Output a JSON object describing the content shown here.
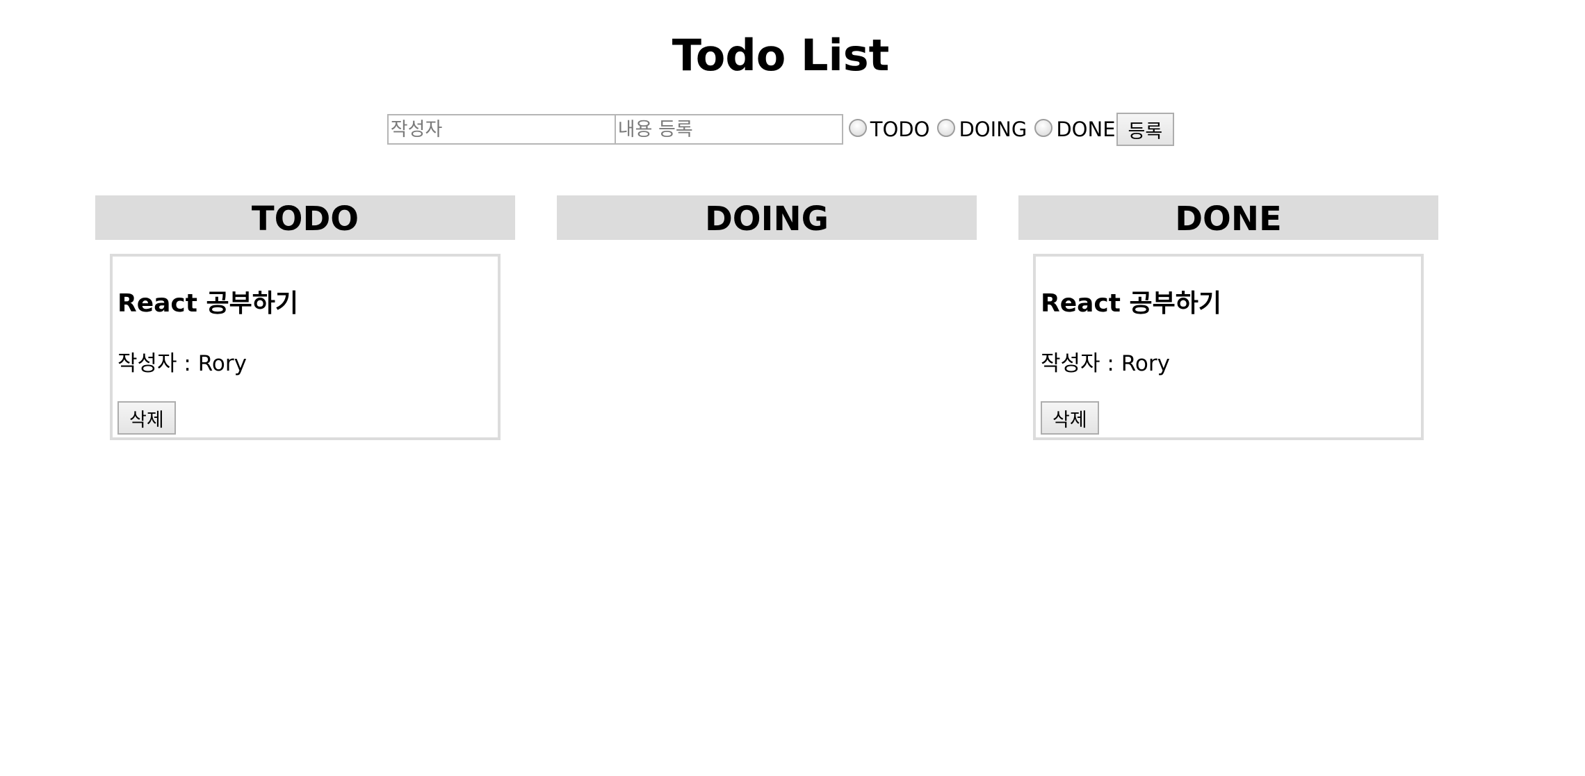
{
  "header": {
    "title": "Todo List"
  },
  "form": {
    "author_placeholder": "작성자",
    "content_placeholder": "내용 등록",
    "status_options": [
      "TODO",
      "DOING",
      "DONE"
    ],
    "submit_label": "등록"
  },
  "columns": [
    {
      "title": "TODO",
      "cards": [
        {
          "title": "React 공부하기",
          "author_line": "작성자 : Rory",
          "delete_label": "삭제"
        }
      ]
    },
    {
      "title": "DOING",
      "cards": []
    },
    {
      "title": "DONE",
      "cards": [
        {
          "title": "React 공부하기",
          "author_line": "작성자 : Rory",
          "delete_label": "삭제"
        }
      ]
    }
  ],
  "colors": {
    "header_bg": "#dcdcdc",
    "card_border": "#dcdcdc",
    "text": "#000000",
    "background": "#ffffff"
  }
}
